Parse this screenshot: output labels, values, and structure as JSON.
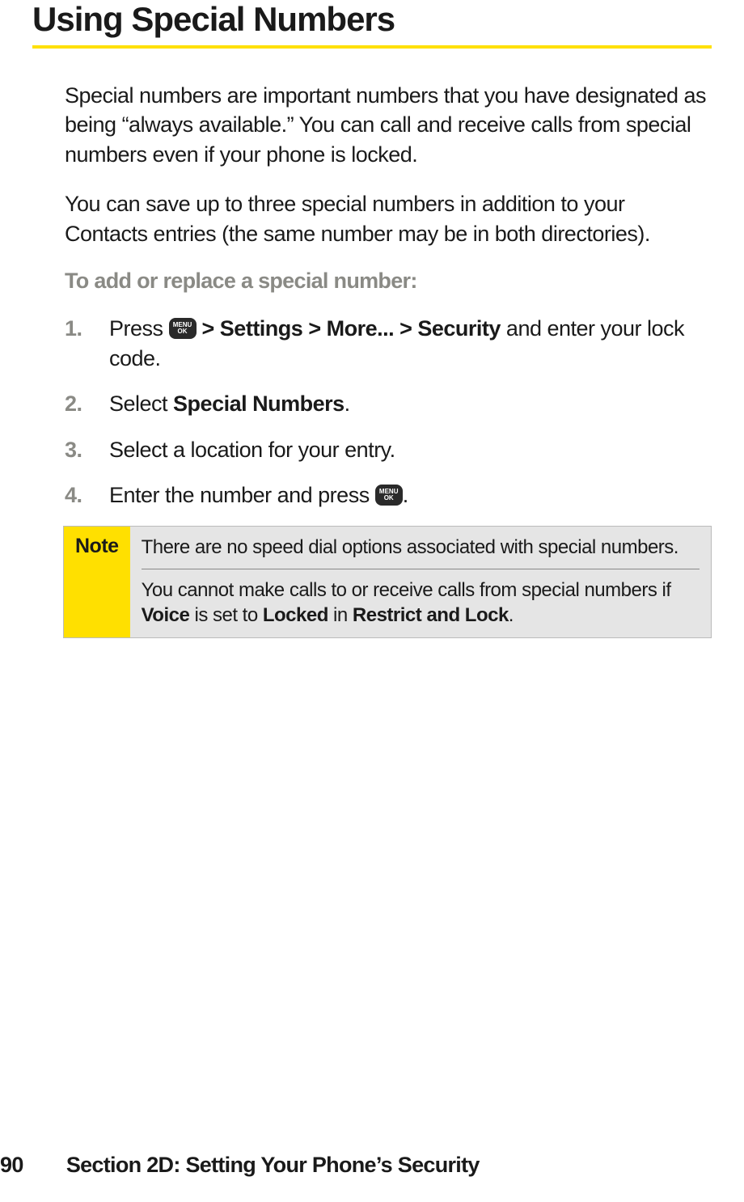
{
  "title": "Using Special Numbers",
  "para1": "Special numbers are important numbers that you have designated as being “always available.” You can call and receive calls from special numbers even if your phone is locked.",
  "para2": "You can save up to three special numbers in addition to your Contacts entries (the same number may be in both directories).",
  "subhead": "To add or replace a special number:",
  "steps": [
    {
      "num": "1.",
      "pre": "Press ",
      "boldpath": " > Settings > More... > Security",
      "post": " and enter your lock code."
    },
    {
      "num": "2.",
      "pre": "Select ",
      "boldpath": "Special Numbers",
      "post": "."
    },
    {
      "num": "3.",
      "text": "Select a location for your entry."
    },
    {
      "num": "4.",
      "pre": "Enter the number and press ",
      "post": "."
    }
  ],
  "icon": {
    "top": "MENU",
    "bottom": "OK"
  },
  "note": {
    "label": "Note",
    "line1": "There are no speed dial options associated with special numbers.",
    "line2_pre": "You cannot make calls to or receive calls from special numbers if ",
    "line2_b1": "Voice",
    "line2_mid1": " is set to ",
    "line2_b2": "Locked",
    "line2_mid2": " in ",
    "line2_b3": "Restrict and Lock",
    "line2_post": "."
  },
  "footer": {
    "page": "90",
    "section": "Section 2D: Setting Your Phone’s Security"
  }
}
